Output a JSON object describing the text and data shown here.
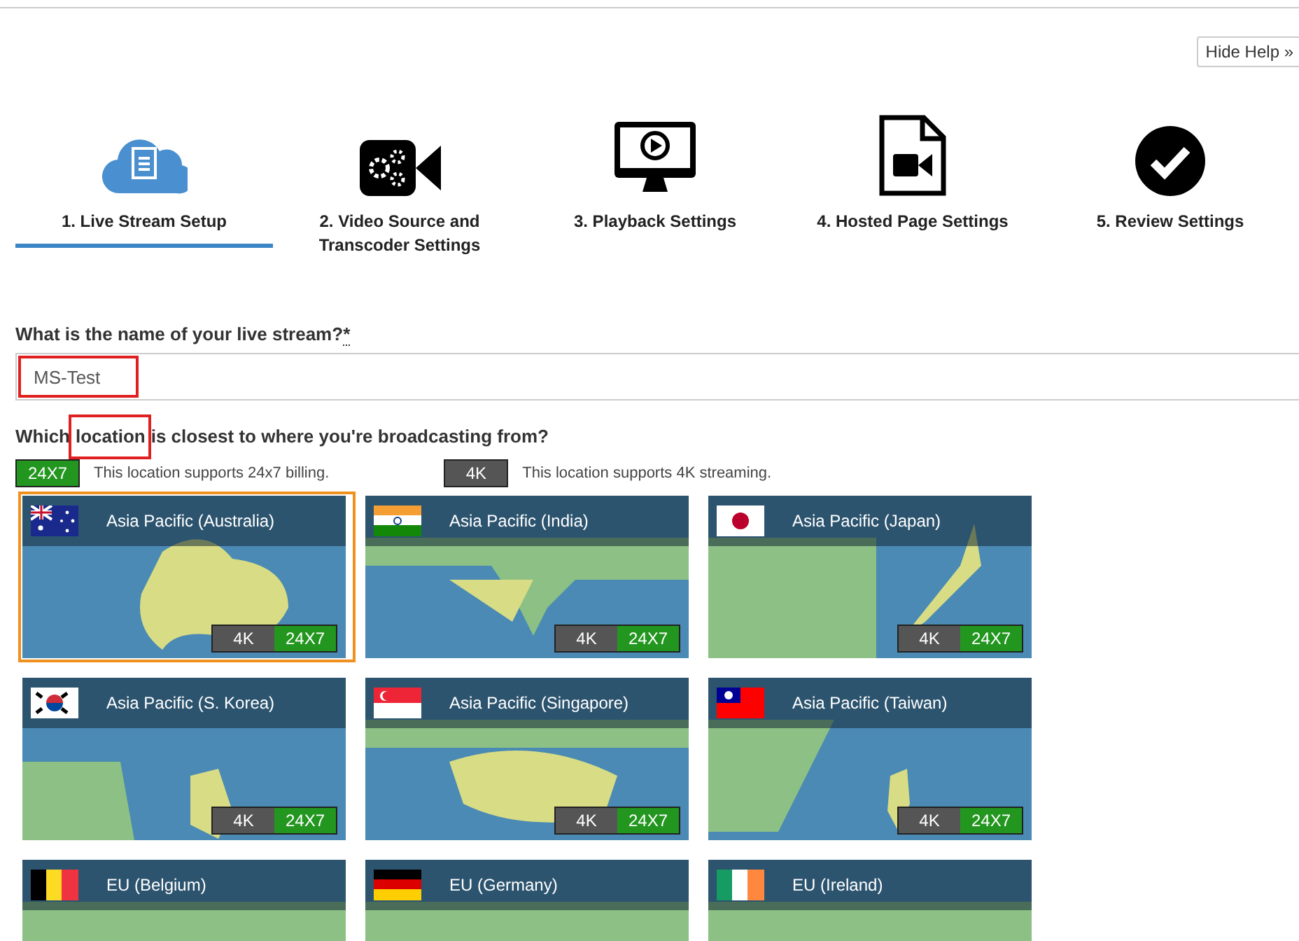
{
  "hide_help_button": "Hide Help »",
  "steps": [
    {
      "label": "1. Live Stream Setup",
      "kind": "cloud",
      "selected": true
    },
    {
      "label": "2. Video Source and Transcoder Settings",
      "kind": "camera",
      "selected": false
    },
    {
      "label": "3. Playback Settings",
      "kind": "monitor",
      "selected": false
    },
    {
      "label": "4. Hosted Page Settings",
      "kind": "document",
      "selected": false
    },
    {
      "label": "5. Review Settings",
      "kind": "check",
      "selected": false
    }
  ],
  "name_question": {
    "label": "What is the name of your live stream?",
    "required_mark": "*",
    "value": "MS-Test"
  },
  "location_question": {
    "before": "Which",
    "highlight": "location",
    "after": "is closest to where you're broadcasting from?"
  },
  "legend": [
    {
      "badge": "24X7",
      "kind": "green",
      "text": "This location supports 24x7 billing."
    },
    {
      "badge": "4K",
      "kind": "grey",
      "text": "This location supports 4K streaming."
    }
  ],
  "locations": [
    {
      "name": "Asia Pacific (Australia)",
      "kind": "australia",
      "selected": true,
      "badges": [
        "4K",
        "24X7"
      ]
    },
    {
      "name": "Asia Pacific (India)",
      "kind": "india",
      "selected": false,
      "badges": [
        "4K",
        "24X7"
      ]
    },
    {
      "name": "Asia Pacific (Japan)",
      "kind": "japan",
      "selected": false,
      "badges": [
        "4K",
        "24X7"
      ]
    },
    {
      "name": "Asia Pacific (S. Korea)",
      "kind": "korea",
      "selected": false,
      "badges": [
        "4K",
        "24X7"
      ]
    },
    {
      "name": "Asia Pacific (Singapore)",
      "kind": "singapore",
      "selected": false,
      "badges": [
        "4K",
        "24X7"
      ]
    },
    {
      "name": "Asia Pacific (Taiwan)",
      "kind": "taiwan",
      "selected": false,
      "badges": [
        "4K",
        "24X7"
      ]
    },
    {
      "name": "EU (Belgium)",
      "kind": "belgium",
      "selected": false
    },
    {
      "name": "EU (Germany)",
      "kind": "germany",
      "selected": false
    },
    {
      "name": "EU (Ireland)",
      "kind": "ireland",
      "selected": false
    }
  ]
}
